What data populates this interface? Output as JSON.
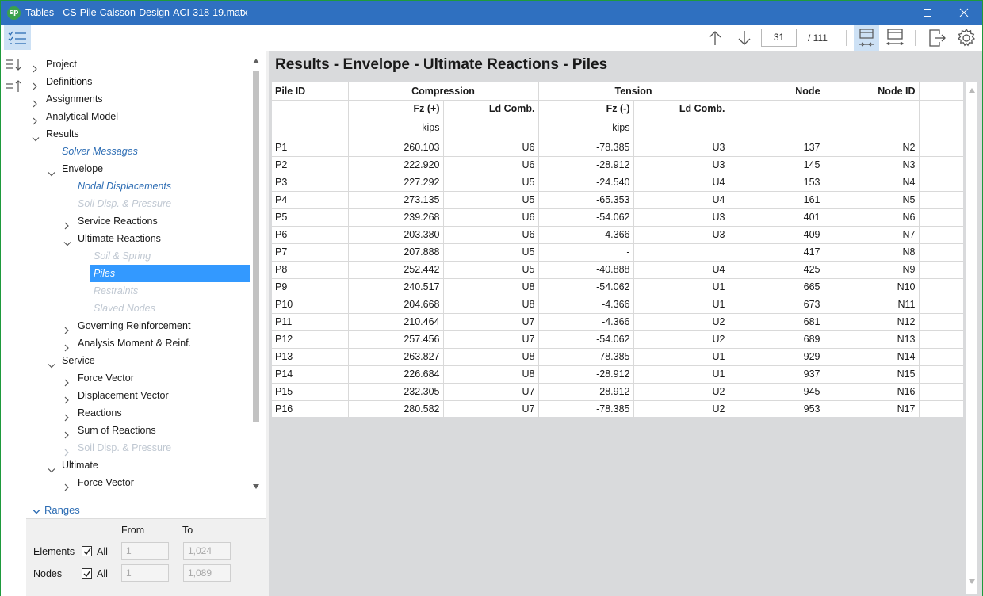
{
  "window": {
    "title": "Tables - CS-Pile-Caisson-Design-ACI-318-19.matx",
    "logo": "sp"
  },
  "toolbar": {
    "current_page": "31",
    "total_pages": "/ 111"
  },
  "tree": [
    {
      "label": "Project",
      "level": 0,
      "chevron": "right",
      "style": "normal"
    },
    {
      "label": "Definitions",
      "level": 0,
      "chevron": "right",
      "style": "normal"
    },
    {
      "label": "Assignments",
      "level": 0,
      "chevron": "right",
      "style": "normal"
    },
    {
      "label": "Analytical Model",
      "level": 0,
      "chevron": "right",
      "style": "normal"
    },
    {
      "label": "Results",
      "level": 0,
      "chevron": "down",
      "style": "normal"
    },
    {
      "label": "Solver Messages",
      "level": 1,
      "chevron": "none",
      "style": "link"
    },
    {
      "label": "Envelope",
      "level": 1,
      "chevron": "down",
      "style": "normal"
    },
    {
      "label": "Nodal Displacements",
      "level": 2,
      "chevron": "none",
      "style": "link"
    },
    {
      "label": "Soil Disp. & Pressure",
      "level": 2,
      "chevron": "none",
      "style": "disabled"
    },
    {
      "label": "Service Reactions",
      "level": 2,
      "chevron": "right",
      "style": "normal"
    },
    {
      "label": "Ultimate Reactions",
      "level": 2,
      "chevron": "down",
      "style": "normal"
    },
    {
      "label": "Soil & Spring",
      "level": 3,
      "chevron": "none",
      "style": "disabled"
    },
    {
      "label": "Piles",
      "level": 3,
      "chevron": "none",
      "style": "selected"
    },
    {
      "label": "Restraints",
      "level": 3,
      "chevron": "none",
      "style": "disabled"
    },
    {
      "label": "Slaved Nodes",
      "level": 3,
      "chevron": "none",
      "style": "disabled"
    },
    {
      "label": "Governing Reinforcement",
      "level": 2,
      "chevron": "right",
      "style": "normal"
    },
    {
      "label": "Analysis Moment & Reinf.",
      "level": 2,
      "chevron": "right",
      "style": "normal"
    },
    {
      "label": "Service",
      "level": 1,
      "chevron": "down",
      "style": "normal"
    },
    {
      "label": "Force Vector",
      "level": 2,
      "chevron": "right",
      "style": "normal"
    },
    {
      "label": "Displacement Vector",
      "level": 2,
      "chevron": "right",
      "style": "normal"
    },
    {
      "label": "Reactions",
      "level": 2,
      "chevron": "right",
      "style": "normal"
    },
    {
      "label": "Sum of Reactions",
      "level": 2,
      "chevron": "right",
      "style": "normal"
    },
    {
      "label": "Soil Disp. & Pressure",
      "level": 2,
      "chevron": "right",
      "style": "disabled-plain"
    },
    {
      "label": "Ultimate",
      "level": 1,
      "chevron": "down",
      "style": "normal"
    },
    {
      "label": "Force Vector",
      "level": 2,
      "chevron": "right",
      "style": "normal"
    }
  ],
  "ranges": {
    "title": "Ranges",
    "from_label": "From",
    "to_label": "To",
    "elements": {
      "label": "Elements",
      "all_label": "All",
      "from": "1",
      "to": "1,024"
    },
    "nodes": {
      "label": "Nodes",
      "all_label": "All",
      "from": "1",
      "to": "1,089"
    }
  },
  "main": {
    "title": "Results - Envelope - Ultimate Reactions - Piles",
    "headers": {
      "pile_id": "Pile ID",
      "compression": "Compression",
      "tension": "Tension",
      "node": "Node",
      "node_id": "Node ID",
      "fz_plus": "Fz (+)",
      "ld_comb_1": "Ld Comb.",
      "fz_minus": "Fz (-)",
      "ld_comb_2": "Ld Comb.",
      "unit_1": "kips",
      "unit_2": "kips"
    },
    "rows": [
      [
        "P1",
        "260.103",
        "U6",
        "-78.385",
        "U3",
        "137",
        "N2"
      ],
      [
        "P2",
        "222.920",
        "U6",
        "-28.912",
        "U3",
        "145",
        "N3"
      ],
      [
        "P3",
        "227.292",
        "U5",
        "-24.540",
        "U4",
        "153",
        "N4"
      ],
      [
        "P4",
        "273.135",
        "U5",
        "-65.353",
        "U4",
        "161",
        "N5"
      ],
      [
        "P5",
        "239.268",
        "U6",
        "-54.062",
        "U3",
        "401",
        "N6"
      ],
      [
        "P6",
        "203.380",
        "U6",
        "-4.366",
        "U3",
        "409",
        "N7"
      ],
      [
        "P7",
        "207.888",
        "U5",
        "-",
        "",
        "417",
        "N8"
      ],
      [
        "P8",
        "252.442",
        "U5",
        "-40.888",
        "U4",
        "425",
        "N9"
      ],
      [
        "P9",
        "240.517",
        "U8",
        "-54.062",
        "U1",
        "665",
        "N10"
      ],
      [
        "P10",
        "204.668",
        "U8",
        "-4.366",
        "U1",
        "673",
        "N11"
      ],
      [
        "P11",
        "210.464",
        "U7",
        "-4.366",
        "U2",
        "681",
        "N12"
      ],
      [
        "P12",
        "257.456",
        "U7",
        "-54.062",
        "U2",
        "689",
        "N13"
      ],
      [
        "P13",
        "263.827",
        "U8",
        "-78.385",
        "U1",
        "929",
        "N14"
      ],
      [
        "P14",
        "226.684",
        "U8",
        "-28.912",
        "U1",
        "937",
        "N15"
      ],
      [
        "P15",
        "232.305",
        "U7",
        "-28.912",
        "U2",
        "945",
        "N16"
      ],
      [
        "P16",
        "280.582",
        "U7",
        "-78.385",
        "U2",
        "953",
        "N17"
      ]
    ]
  }
}
